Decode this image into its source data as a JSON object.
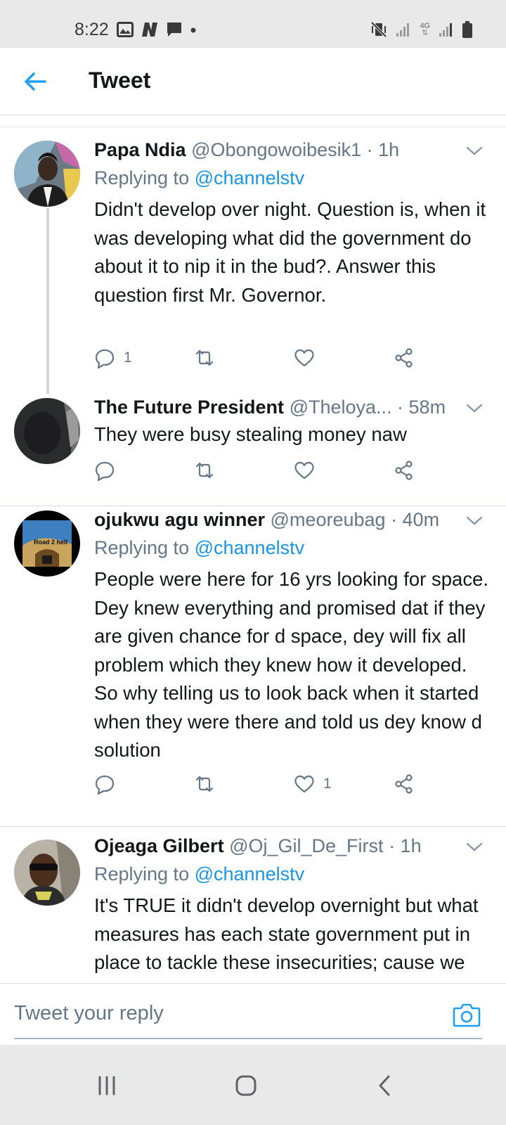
{
  "status_bar": {
    "time": "8:22",
    "left_icons": [
      "gallery-icon",
      "n-app-icon",
      "message-icon",
      "dot-icon"
    ],
    "right_icons": [
      "mute-vibrate-icon",
      "signal-icon",
      "4g-icon",
      "signal-icon",
      "battery-icon"
    ],
    "network_label": "4G"
  },
  "header": {
    "title": "Tweet"
  },
  "tweets": [
    {
      "name": "Papa Ndia",
      "handle": "@Obongowoibesik1",
      "time": "· 1h",
      "replying_prefix": "Replying to ",
      "replying_to": "@channelstv",
      "text": "Didn't develop over night. Question is, when it was developing what did the government do about it to nip it in the bud?. Answer this question first Mr. Governor.",
      "reply_count": "1",
      "retweet_count": "",
      "like_count": ""
    },
    {
      "name": "The Future President",
      "handle": "@Theloya...",
      "time": "· 58m",
      "text": "They were busy stealing money naw",
      "reply_count": "",
      "retweet_count": "",
      "like_count": ""
    },
    {
      "name": "ojukwu agu winner",
      "handle": "@meoreubag",
      "time": "· 40m",
      "replying_prefix": "Replying to ",
      "replying_to": "@channelstv",
      "text": "People were here for 16 yrs looking for space. Dey knew everything and promised dat if they are given chance for d space, dey will fix all problem which they knew how it developed. So why telling us to look back when it started when they were there and told us dey know d solution",
      "avatar_caption": "Road 2 hell",
      "reply_count": "",
      "retweet_count": "",
      "like_count": "1"
    },
    {
      "name": "Ojeaga Gilbert",
      "handle": "@Oj_Gil_De_First",
      "time": "· 1h",
      "replying_prefix": "Replying to ",
      "replying_to": "@channelstv",
      "text": "It's TRUE it didn't develop overnight but what measures has each state government put in place to tackle these insecurities; cause we just can't depend on"
    }
  ],
  "composer": {
    "placeholder": "Tweet your reply"
  },
  "colors": {
    "accent": "#1da1f2",
    "link": "#1b95e0",
    "secondary_text": "#657786",
    "primary_text": "#14171a",
    "divider": "#d8dde1",
    "system_bar": "#e9e9ea"
  }
}
